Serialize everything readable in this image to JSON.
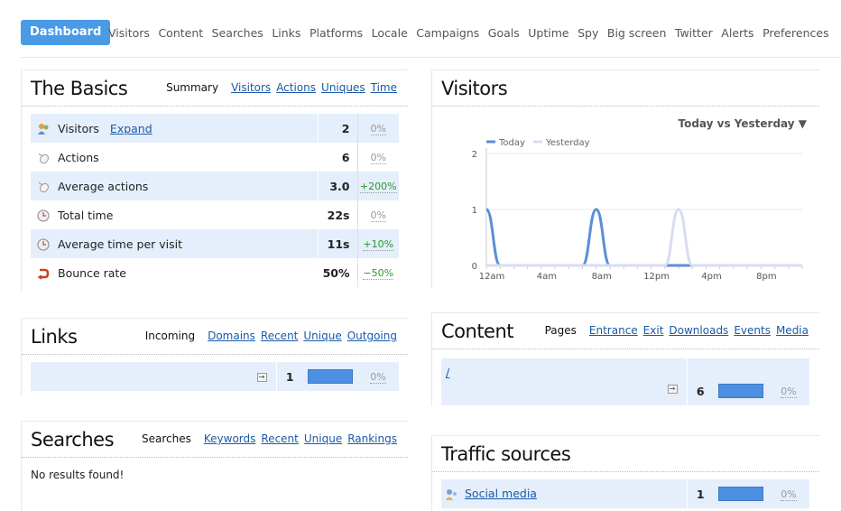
{
  "nav": {
    "active": "Dashboard",
    "items": [
      "Visitors",
      "Content",
      "Searches",
      "Links",
      "Platforms",
      "Locale",
      "Campaigns",
      "Goals",
      "Uptime",
      "Spy",
      "Big screen",
      "Twitter",
      "Alerts",
      "Preferences"
    ]
  },
  "basics": {
    "title": "The Basics",
    "current_tab": "Summary",
    "tabs": [
      "Visitors",
      "Actions",
      "Uniques",
      "Time"
    ],
    "rows": [
      {
        "icon": "visitors-icon",
        "label": "Visitors",
        "link": "Expand",
        "value": "2",
        "pct": "0%",
        "trend": "none"
      },
      {
        "icon": "mouse-icon",
        "label": "Actions",
        "link": "",
        "value": "6",
        "pct": "0%",
        "trend": "none"
      },
      {
        "icon": "mouse-icon",
        "label": "Average actions",
        "link": "",
        "value": "3.0",
        "pct": "+200%",
        "trend": "pos"
      },
      {
        "icon": "clock-icon",
        "label": "Total time",
        "link": "",
        "value": "22s",
        "pct": "0%",
        "trend": "none"
      },
      {
        "icon": "clock-icon",
        "label": "Average time per visit",
        "link": "",
        "value": "11s",
        "pct": "+10%",
        "trend": "pos"
      },
      {
        "icon": "bounce-icon",
        "label": "Bounce rate",
        "link": "",
        "value": "50%",
        "pct": "−50%",
        "trend": "neg"
      }
    ]
  },
  "visitors_panel": {
    "title": "Visitors",
    "compare": "Today vs Yesterday ▼"
  },
  "chart_data": {
    "type": "line",
    "x_ticks": [
      "12am",
      "4am",
      "8am",
      "12pm",
      "4pm",
      "8pm"
    ],
    "ylim": [
      0,
      2
    ],
    "y_ticks": [
      "0",
      "1",
      "2"
    ],
    "legend_position": "top-left",
    "series": [
      {
        "name": "Today",
        "color": "#5b8fd6",
        "x": [
          0,
          1,
          2,
          3,
          4,
          5,
          6,
          7,
          8,
          9,
          10,
          11,
          12,
          13,
          14,
          15,
          16,
          17,
          18,
          19,
          20,
          21,
          22,
          23
        ],
        "values": [
          1,
          0,
          0,
          0,
          0,
          0,
          0,
          0,
          1,
          0,
          0,
          0,
          0,
          0,
          0,
          0,
          0,
          0,
          0,
          0,
          0,
          0,
          0,
          0
        ]
      },
      {
        "name": "Yesterday",
        "color": "#d9dcf2",
        "x": [
          0,
          1,
          2,
          3,
          4,
          5,
          6,
          7,
          8,
          9,
          10,
          11,
          12,
          13,
          14,
          15,
          16,
          17,
          18,
          19,
          20,
          21,
          22,
          23
        ],
        "values": [
          0,
          0,
          0,
          0,
          0,
          0,
          0,
          0,
          0,
          0,
          0,
          0,
          0,
          0,
          1,
          0,
          0,
          0,
          0,
          0,
          0,
          0,
          0,
          0
        ]
      }
    ]
  },
  "links": {
    "title": "Links",
    "current_tab": "Incoming",
    "tabs": [
      "Domains",
      "Recent",
      "Unique",
      "Outgoing"
    ],
    "rows": [
      {
        "label": "",
        "value": "1",
        "pct": "0%",
        "bar": 1.0
      }
    ]
  },
  "searches": {
    "title": "Searches",
    "current_tab": "Searches",
    "tabs": [
      "Keywords",
      "Recent",
      "Unique",
      "Rankings"
    ],
    "empty": "No results found!"
  },
  "content": {
    "title": "Content",
    "current_tab": "Pages",
    "tabs": [
      "Entrance",
      "Exit",
      "Downloads",
      "Events",
      "Media"
    ],
    "rows": [
      {
        "label": "/",
        "value": "6",
        "pct": "0%",
        "bar": 1.0
      }
    ]
  },
  "traffic": {
    "title": "Traffic sources",
    "rows": [
      {
        "icon": "social-media-icon",
        "label": "Social media",
        "value": "1",
        "pct": "0%",
        "bar": 1.0
      }
    ]
  }
}
